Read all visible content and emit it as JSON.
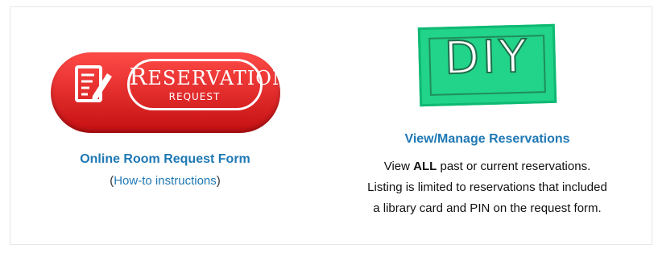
{
  "left": {
    "badge": {
      "word_initial": "R",
      "word_rest": "ESERVATION",
      "subword": "REQUEST",
      "icon": "checklist-pencil-icon",
      "pill_color": "#e2201e"
    },
    "link_label": "Online Room Request Form",
    "howto_open": "(",
    "howto_link": "How-to instructions",
    "howto_close": ")"
  },
  "right": {
    "badge": {
      "text": "DIY",
      "tile_color": "#22d38a"
    },
    "link_label": "View/Manage Reservations",
    "desc_line1_pre": "View ",
    "desc_line1_bold": "ALL",
    "desc_line1_post": " past or current reservations.",
    "desc_line2": "Listing is limited to reservations that included",
    "desc_line3": "a library card and PIN on the request form."
  },
  "colors": {
    "link": "#1f78b4",
    "text": "#111111"
  }
}
